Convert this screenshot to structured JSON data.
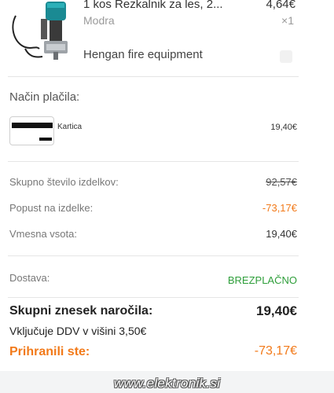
{
  "product": {
    "title": "1 kos Rezkalnik za les, 2...",
    "variant": "Modra",
    "price": "4,64€",
    "quantity": "×1",
    "store": "Hengan fire equipment"
  },
  "payment": {
    "section_title": "Način plačila:",
    "method_label": "Kartica",
    "amount": "19,40€"
  },
  "summary": {
    "items_total_label": "Skupno število izdelkov:",
    "items_total_value": "92,57€",
    "discount_label": "Popust na izdelke:",
    "discount_value": "-73,17€",
    "subtotal_label": "Vmesna vsota:",
    "subtotal_value": "19,40€",
    "shipping_label": "Dostava:",
    "shipping_value": "BREZPLAČNO",
    "order_total_label": "Skupni znesek naročila:",
    "order_total_value": "19,40€",
    "vat_text": "Vključuje DDV v višini 3,50€",
    "saved_label": "Prihranili ste:",
    "saved_value": "-73,17€"
  },
  "watermark": "www.elektronik.si",
  "colors": {
    "accent_orange": "#f27a1a",
    "free_green": "#2e9e3a"
  }
}
